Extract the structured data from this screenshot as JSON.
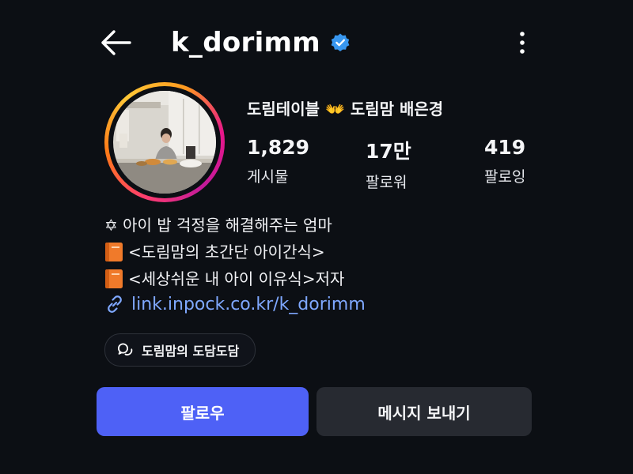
{
  "header": {
    "username": "k_dorimm"
  },
  "profile": {
    "display_name": "도림테이블 👐 도림맘 배은경",
    "stats": [
      {
        "value": "1,829",
        "label": "게시물"
      },
      {
        "value": "17만",
        "label": "팔로워"
      },
      {
        "value": "419",
        "label": "팔로잉"
      }
    ]
  },
  "bio": {
    "lines": [
      "✡ 아이 밥 걱정을 해결해주는 엄마",
      "<도림맘의 초간단 아이간식>",
      " <세상쉬운 내 아이 이유식>저자"
    ],
    "link": "link.inpock.co.kr/k_dorimm"
  },
  "chip": {
    "label": "도림맘의 도담도담"
  },
  "actions": {
    "follow_label": "팔로우",
    "message_label": "메시지 보내기"
  },
  "colors": {
    "background": "#0c0f14",
    "follow_button": "#4e61f6",
    "message_button": "#272a31",
    "link": "#7fa8ff",
    "verified_badge": "#3897f0"
  }
}
